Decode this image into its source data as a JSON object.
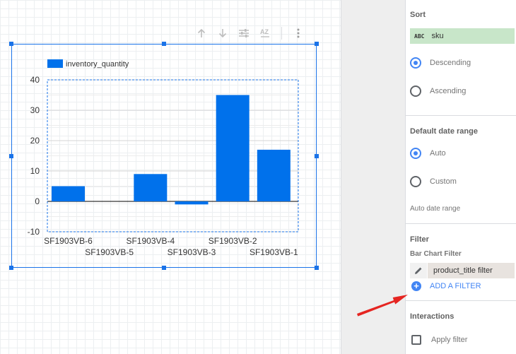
{
  "toolbar": {
    "icons": [
      "arrow-up-icon",
      "arrow-down-icon",
      "tune-icon",
      "sort-az-icon",
      "more-vert-icon"
    ],
    "az_label": "AZ"
  },
  "chart_data": {
    "type": "bar",
    "categories": [
      "SF1903VB-6",
      "SF1903VB-5",
      "SF1903VB-4",
      "SF1903VB-3",
      "SF1903VB-2",
      "SF1903VB-1"
    ],
    "series": [
      {
        "name": "inventory_quantity",
        "values": [
          5,
          0,
          9,
          -1,
          35,
          17
        ]
      }
    ],
    "ylim": [
      -10,
      40
    ],
    "yticks": [
      40,
      30,
      20,
      10,
      0,
      -10
    ],
    "grid": true,
    "legend": "top-left",
    "bar_color": "#0071eb"
  },
  "panel": {
    "sort": {
      "title": "Sort",
      "field_type": "ABC",
      "field": "sku",
      "options": [
        {
          "label": "Descending",
          "checked": true
        },
        {
          "label": "Ascending",
          "checked": false
        }
      ]
    },
    "date_range": {
      "title": "Default date range",
      "options": [
        {
          "label": "Auto",
          "checked": true
        },
        {
          "label": "Custom",
          "checked": false
        }
      ],
      "note": "Auto date range"
    },
    "filter": {
      "title": "Filter",
      "subtitle": "Bar Chart Filter",
      "chip": "product_title filter",
      "add_label": "ADD A FILTER"
    },
    "interactions": {
      "title": "Interactions",
      "apply_filter": "Apply filter"
    }
  },
  "colors": {
    "accent": "#4285f4",
    "selection": "#1a73e8",
    "sort_chip": "#c8e6c9",
    "annotation_arrow": "#e52521"
  }
}
